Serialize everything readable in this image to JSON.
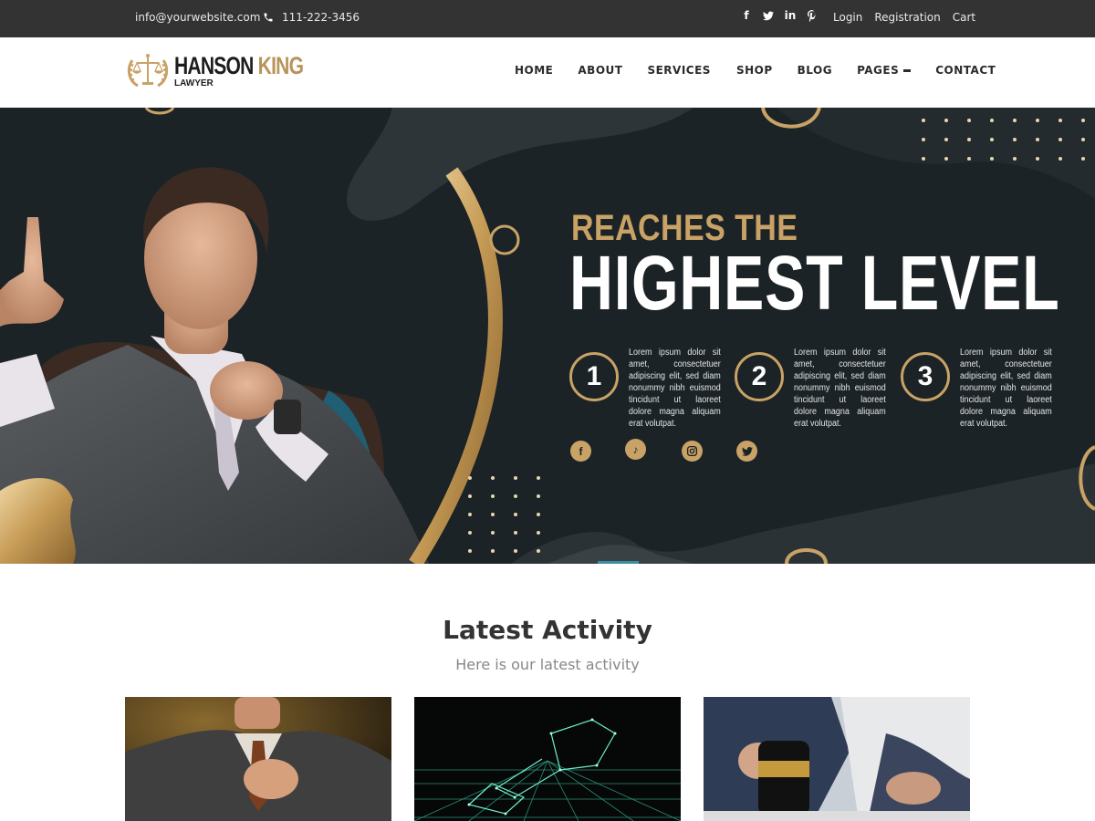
{
  "topbar": {
    "email": "info@yourwebsite.com",
    "phone": "111-222-3456",
    "social_icons": [
      "facebook-icon",
      "twitter-icon",
      "linkedin-icon",
      "pinterest-icon"
    ],
    "links": [
      "Login",
      "Registration",
      "Cart"
    ]
  },
  "brand": {
    "name_part1": "HANSON",
    "name_part2": "KING",
    "subtitle": "LAWYER",
    "logo_icon": "scales-of-justice-icon"
  },
  "nav": {
    "items": [
      "HOME",
      "ABOUT",
      "SERVICES",
      "SHOP",
      "BLOG",
      "PAGES",
      "CONTACT"
    ]
  },
  "hero": {
    "line1": "REACHES THE",
    "line2": "HIGHEST LEVEL",
    "steps": [
      {
        "num": "1",
        "text": "Lorem ipsum dolor sit amet, consectetuer adipiscing elit, sed diam nonummy nibh euismod tincidunt ut laoreet dolore magna aliquam erat volutpat."
      },
      {
        "num": "2",
        "text": "Lorem ipsum dolor sit amet, consectetuer adipiscing elit, sed diam nonummy nibh euismod tincidunt ut laoreet dolore magna aliquam erat volutpat."
      },
      {
        "num": "3",
        "text": "Lorem ipsum dolor sit amet, consectetuer adipiscing elit, sed diam nonummy nibh euismod tincidunt ut laoreet dolore magna aliquam erat volutpat."
      }
    ],
    "social_icons": [
      "facebook-icon",
      "tiktok-icon",
      "instagram-icon",
      "twitter-icon"
    ]
  },
  "latest": {
    "title": "Latest Activity",
    "subtitle": "Here is our latest activity"
  },
  "colors": {
    "gold": "#c9a266",
    "dark": "#1b2326",
    "topbar": "#333333"
  }
}
